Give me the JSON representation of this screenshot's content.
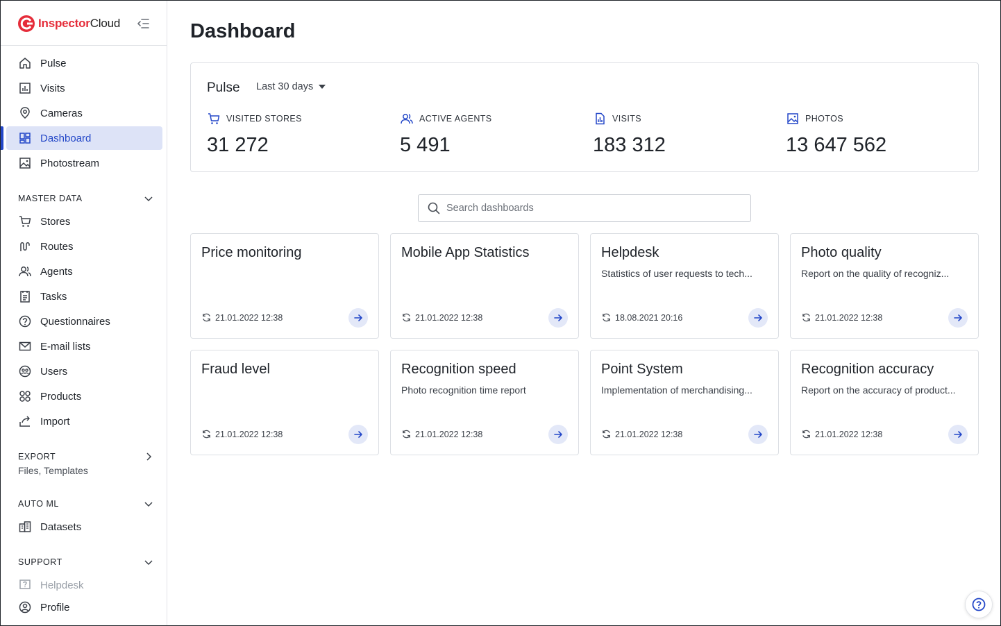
{
  "brand": {
    "name_part1": "Inspector",
    "name_part2": "Cloud",
    "color": "#e52d3a"
  },
  "colors": {
    "accent": "#2347c8",
    "active_bg": "#dde3f7"
  },
  "sidebar": {
    "main_items": [
      {
        "label": "Pulse",
        "icon": "home-icon"
      },
      {
        "label": "Visits",
        "icon": "chart-icon"
      },
      {
        "label": "Cameras",
        "icon": "pin-icon"
      },
      {
        "label": "Dashboard",
        "icon": "dashboard-icon",
        "active": true
      },
      {
        "label": "Photostream",
        "icon": "image-icon"
      }
    ],
    "master_data": {
      "title": "MASTER DATA",
      "items": [
        {
          "label": "Stores",
          "icon": "cart-icon"
        },
        {
          "label": "Routes",
          "icon": "route-icon"
        },
        {
          "label": "Agents",
          "icon": "users-icon"
        },
        {
          "label": "Tasks",
          "icon": "clipboard-icon"
        },
        {
          "label": "Questionnaires",
          "icon": "question-icon"
        },
        {
          "label": "E-mail lists",
          "icon": "mail-icon"
        },
        {
          "label": "Users",
          "icon": "user-group-icon"
        },
        {
          "label": "Products",
          "icon": "products-icon"
        },
        {
          "label": "Import",
          "icon": "import-icon"
        }
      ]
    },
    "export": {
      "title": "EXPORT",
      "subtitle": "Files, Templates"
    },
    "auto_ml": {
      "title": "AUTO ML",
      "items": [
        {
          "label": "Datasets",
          "icon": "datasets-icon"
        }
      ]
    },
    "support": {
      "title": "SUPPORT",
      "items": [
        {
          "label": "Helpdesk",
          "icon": "helpdesk-icon"
        },
        {
          "label": "Profile",
          "icon": "profile-icon"
        }
      ]
    }
  },
  "main": {
    "title": "Dashboard",
    "pulse": {
      "title": "Pulse",
      "period": "Last 30 days",
      "metrics": [
        {
          "label": "VISITED STORES",
          "value": "31 272",
          "icon": "cart-icon"
        },
        {
          "label": "ACTIVE AGENTS",
          "value": "5 491",
          "icon": "users-icon"
        },
        {
          "label": "VISITS",
          "value": "183 312",
          "icon": "chart-icon"
        },
        {
          "label": "PHOTOS",
          "value": "13 647 562",
          "icon": "image-icon"
        }
      ]
    },
    "search": {
      "placeholder": "Search dashboards",
      "value": ""
    },
    "dashboards": [
      {
        "title": "Price monitoring",
        "description": "",
        "updated": "21.01.2022 12:38"
      },
      {
        "title": "Mobile App Statistics",
        "description": "",
        "updated": "21.01.2022 12:38"
      },
      {
        "title": "Helpdesk",
        "description": "Statistics of user requests to tech...",
        "updated": "18.08.2021 20:16"
      },
      {
        "title": "Photo quality",
        "description": "Report on the quality of recogniz...",
        "updated": "21.01.2022 12:38"
      },
      {
        "title": "Fraud level",
        "description": "",
        "updated": "21.01.2022 12:38"
      },
      {
        "title": "Recognition speed",
        "description": "Photo recognition time report",
        "updated": "21.01.2022 12:38"
      },
      {
        "title": "Point System",
        "description": "Implementation of merchandising...",
        "updated": "21.01.2022 12:38"
      },
      {
        "title": "Recognition accuracy",
        "description": "Report on the accuracy of product...",
        "updated": "21.01.2022 12:38"
      }
    ]
  }
}
